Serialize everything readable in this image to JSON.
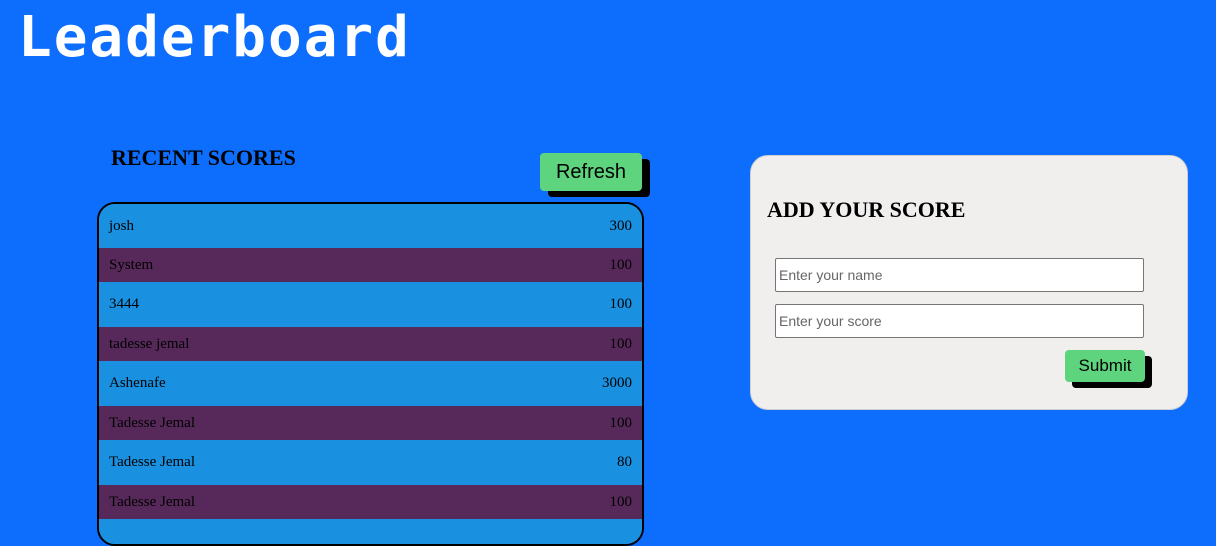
{
  "header": {
    "title": "Leaderboard"
  },
  "recent": {
    "title": "RECENT SCORES",
    "refresh_label": "Refresh",
    "scores": [
      {
        "name": "josh",
        "score": "300"
      },
      {
        "name": "System",
        "score": "100"
      },
      {
        "name": "3444",
        "score": "100"
      },
      {
        "name": "tadesse jemal",
        "score": "100"
      },
      {
        "name": "Ashenafe",
        "score": "3000"
      },
      {
        "name": "Tadesse Jemal",
        "score": "100"
      },
      {
        "name": "Tadesse Jemal",
        "score": "80"
      },
      {
        "name": "Tadesse Jemal",
        "score": "100"
      },
      {
        "name": "",
        "score": ""
      }
    ]
  },
  "form": {
    "title": "ADD YOUR SCORE",
    "name_placeholder": "Enter your name",
    "name_value": "",
    "score_placeholder": "Enter your score",
    "score_value": "",
    "submit_label": "Submit"
  },
  "colors": {
    "background": "#0d6efd",
    "row_light": "#1a91e0",
    "row_dark": "#57295a",
    "button": "#5dd47d",
    "card": "#f1eeee"
  }
}
